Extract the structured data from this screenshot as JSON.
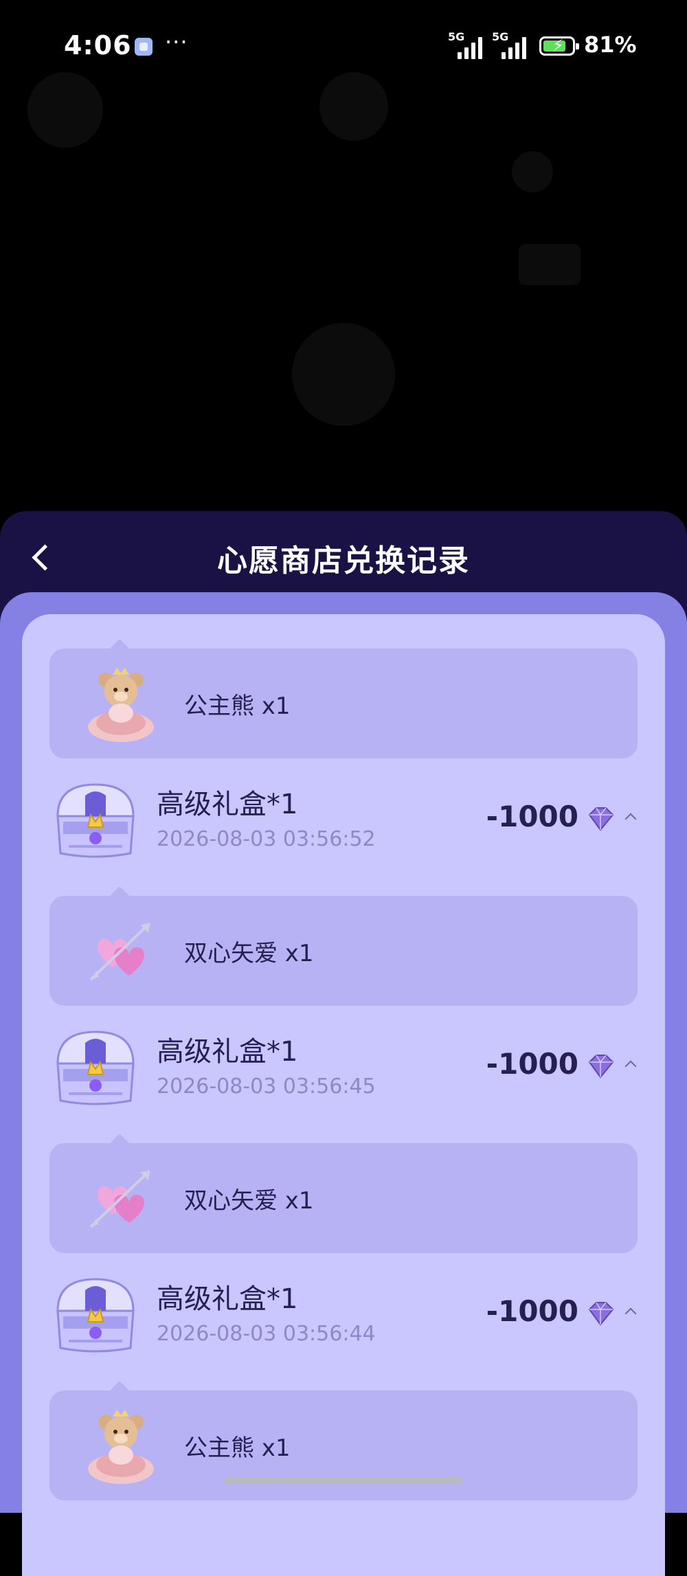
{
  "status_bar": {
    "time": "4:06",
    "dots": "···",
    "network_1": "5G",
    "network_2": "5G",
    "battery_percent": "81%",
    "battery_level": 0.81
  },
  "sheet": {
    "title": "心愿商店兑换记录"
  },
  "records": [
    {
      "title": "高级礼盒*1",
      "date": "2026-08-03 03:56:52",
      "amount": "-1000"
    },
    {
      "title": "高级礼盒*1",
      "date": "2026-08-03 03:56:45",
      "amount": "-1000"
    },
    {
      "title": "高级礼盒*1",
      "date": "2026-08-03 03:56:44",
      "amount": "-1000"
    }
  ],
  "gifts": [
    {
      "label": "公主熊 x1",
      "icon": "teddy-bear-icon"
    },
    {
      "label": "双心矢爱 x1",
      "icon": "double-heart-arrow-icon"
    },
    {
      "label": "双心矢爱 x1",
      "icon": "double-heart-arrow-icon"
    },
    {
      "label": "公主熊 x1",
      "icon": "teddy-bear-icon"
    }
  ],
  "colors": {
    "sheet_header": "#1a1145",
    "outer_panel": "#8580e3",
    "inner_panel": "#cac6ff",
    "gift_card": "#b7b2f4",
    "text_dark": "#252050",
    "text_date": "#8d88c8"
  }
}
